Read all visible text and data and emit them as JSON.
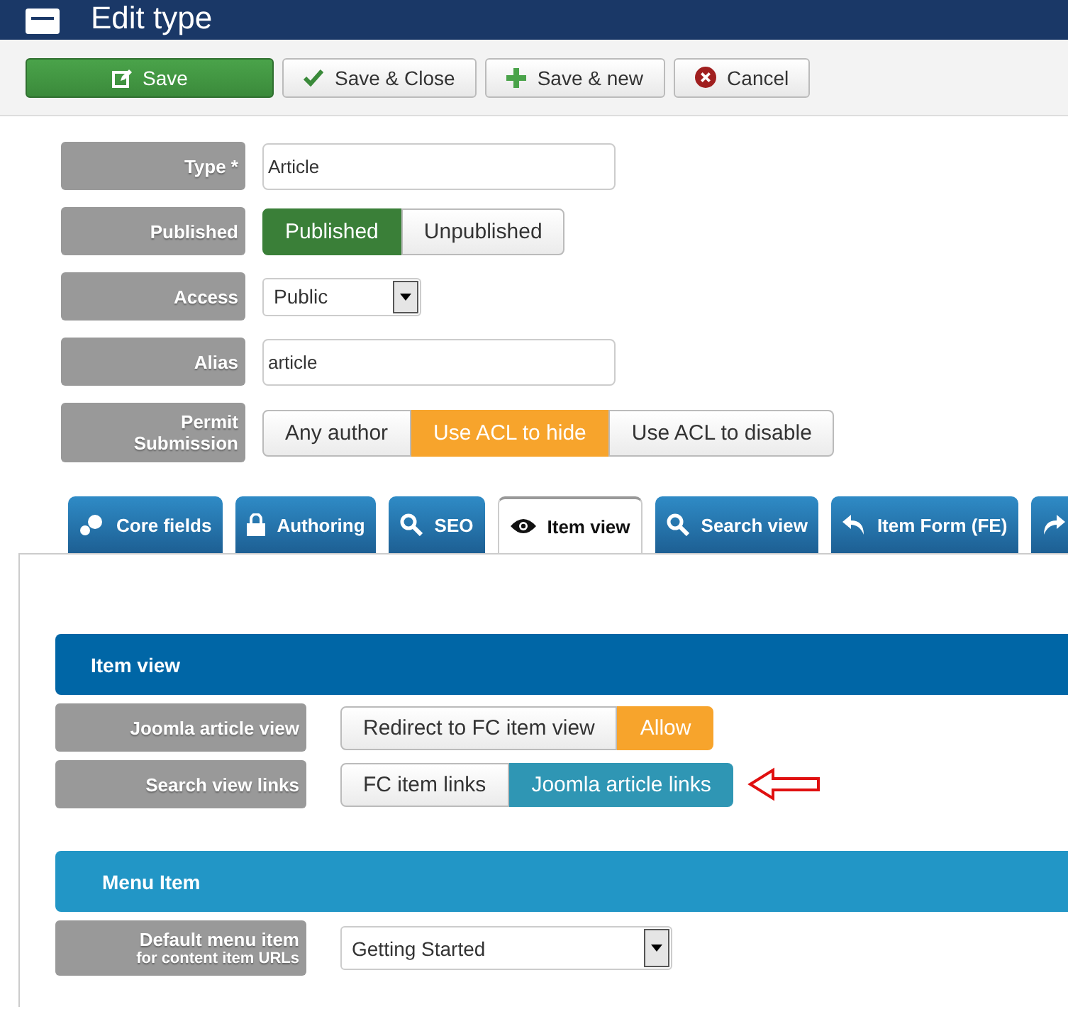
{
  "header": {
    "title": "Edit type"
  },
  "toolbar": [
    {
      "label": "Save",
      "kind": "primary"
    },
    {
      "label": "Save & Close",
      "kind": "check"
    },
    {
      "label": "Save & new",
      "kind": "plus"
    },
    {
      "label": "Cancel",
      "kind": "cancel"
    }
  ],
  "fields": [
    {
      "label": "Type *",
      "kind": "text",
      "value": "Article"
    },
    {
      "label": "Published",
      "kind": "toggle",
      "options": [
        {
          "label": "Published",
          "selected": true
        },
        {
          "label": "Unpublished",
          "selected": false
        }
      ]
    },
    {
      "label": "Access",
      "kind": "select",
      "value": "Public"
    },
    {
      "label": "Alias",
      "kind": "text",
      "value": "article"
    },
    {
      "label": "Permit Submission",
      "kind": "toggle",
      "options": [
        {
          "label": "Any author",
          "selected": false
        },
        {
          "label": "Use ACL to hide",
          "selected": true
        },
        {
          "label": "Use ACL to disable",
          "selected": false
        }
      ]
    }
  ],
  "tabs": [
    {
      "label": "Core fields",
      "selected": false
    },
    {
      "label": "Authoring",
      "selected": false
    },
    {
      "label": "SEO",
      "selected": false
    },
    {
      "label": "Item view",
      "selected": true
    },
    {
      "label": "Search view",
      "selected": false
    },
    {
      "label": "Item Form (FE)",
      "selected": false
    },
    {
      "selected": false
    }
  ],
  "sections": [
    {
      "title": "Item view",
      "rows": [
        {
          "label": "Joomla article view",
          "kind": "toggle",
          "pointer": false,
          "options": [
            {
              "label": "Redirect to FC item view",
              "selected": false
            },
            {
              "label": "Allow",
              "selected": true
            }
          ]
        },
        {
          "label": "Search view links",
          "kind": "toggle",
          "pointer": true,
          "options": [
            {
              "label": "FC item links",
              "selected": false
            },
            {
              "label": "Joomla article links",
              "selected": true
            }
          ]
        }
      ]
    },
    {
      "title": "Menu Item",
      "rows": [
        {
          "label": "Default menu item",
          "sublabel": "for content item URLs",
          "kind": "select",
          "pointer": false,
          "value": "Getting Started"
        }
      ]
    }
  ]
}
